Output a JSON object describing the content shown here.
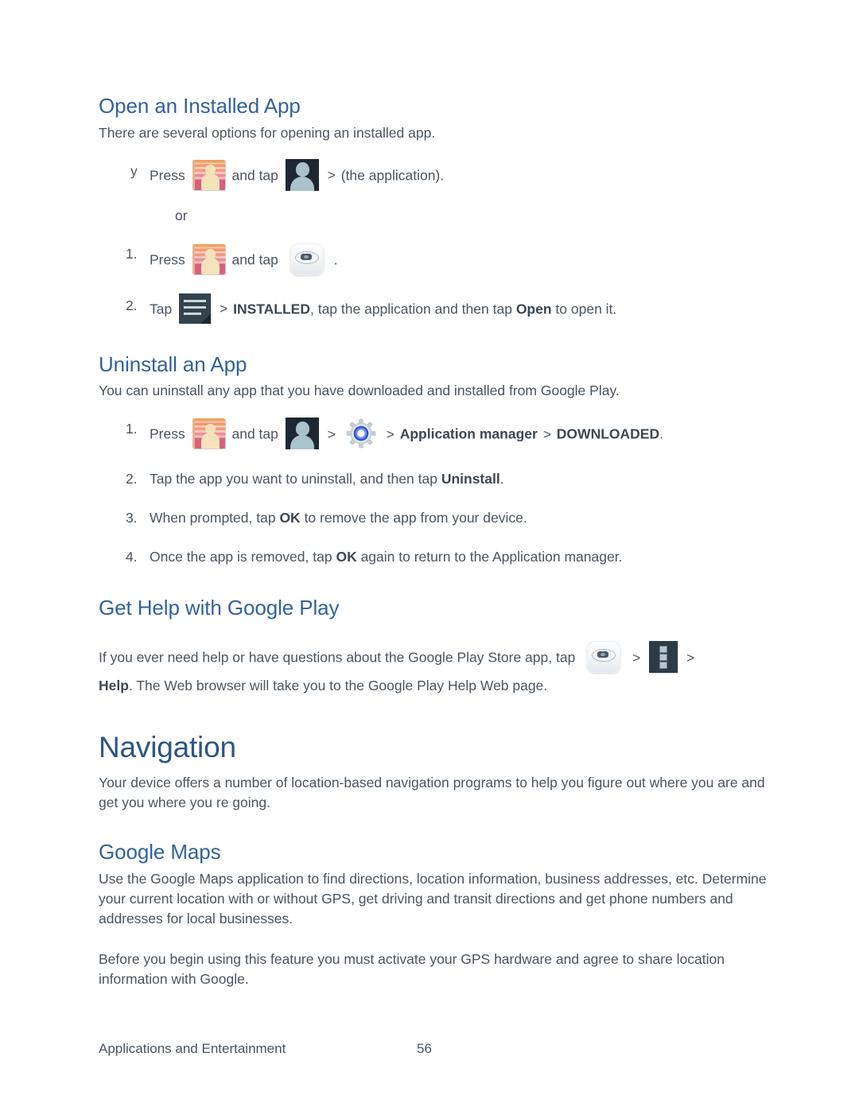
{
  "document": {
    "footer_title": "Applications and Entertainment",
    "page_number": "56"
  },
  "sections": {
    "open_installed_app": {
      "heading": "Open an Installed App",
      "intro": "There are several options for opening an installed app.",
      "bullet_marker": "y",
      "bullet_press": "Press",
      "bullet_and_tap": "and tap",
      "bullet_separator": ">",
      "bullet_tail": "(the application).",
      "or_text": "or",
      "step1_num": "1.",
      "step1_press": "Press",
      "step1_and_tap": "and tap",
      "step1_tail": ".",
      "step2_num": "2.",
      "step2_tap": "Tap",
      "step2_separator": ">",
      "step2_installed": "INSTALLED",
      "step2_mid": ", tap the application and then tap",
      "step2_open": "Open",
      "step2_tail": "to open it."
    },
    "uninstall_app": {
      "heading": "Uninstall an App",
      "intro": "You can uninstall any app that you have downloaded and installed from Google Play.",
      "step1_num": "1.",
      "step1_press": "Press",
      "step1_and_tap": "and tap",
      "step1_sep1": ">",
      "step1_sep2": ">",
      "step1_app_manager": "Application manager",
      "step1_sep3": ">",
      "step1_downloaded": "DOWNLOADED",
      "step1_tail": ".",
      "step2_num": "2.",
      "step2_pre": "Tap the app you want to uninstall, and then tap",
      "step2_bold": "Uninstall",
      "step2_tail": ".",
      "step3_num": "3.",
      "step3_pre": "When prompted, tap",
      "step3_bold": "OK",
      "step3_tail": "to remove the app from your device.",
      "step4_num": "4.",
      "step4_pre": "Once the app is removed, tap",
      "step4_bold": "OK",
      "step4_tail": "again to return to the Application manager."
    },
    "get_help": {
      "heading": "Get Help with Google Play",
      "para_pre": "If you ever need help or have questions about the Google Play Store app, tap",
      "sep1": ">",
      "sep2": ">",
      "para_bold": "Help",
      "para_post": ". The Web browser will take you to the Google Play Help Web page."
    },
    "navigation": {
      "heading": "Navigation",
      "para": "Your device offers a number of location-based navigation programs to help you figure out where you are and get you where you re going."
    },
    "google_maps": {
      "heading": "Google Maps",
      "para1": "Use the Google Maps application to find directions, location information, business addresses, etc. Determine your current location with or without GPS, get driving and transit directions and get phone numbers and addresses for local businesses.",
      "para2": "Before you begin using this feature you must activate your GPS hardware and agree to share location information with Google."
    }
  },
  "icons": {
    "contacts": "contacts-book-icon",
    "apps_person": "apps-person-icon",
    "play_store": "play-store-puck-icon",
    "menu_list": "menu-list-icon",
    "settings_gear": "settings-gear-icon",
    "overflow_kebab": "overflow-kebab-icon"
  },
  "colors": {
    "heading_blue": "#33629b",
    "chapter_blue": "#2e5584",
    "body_text": "#4a5560"
  }
}
